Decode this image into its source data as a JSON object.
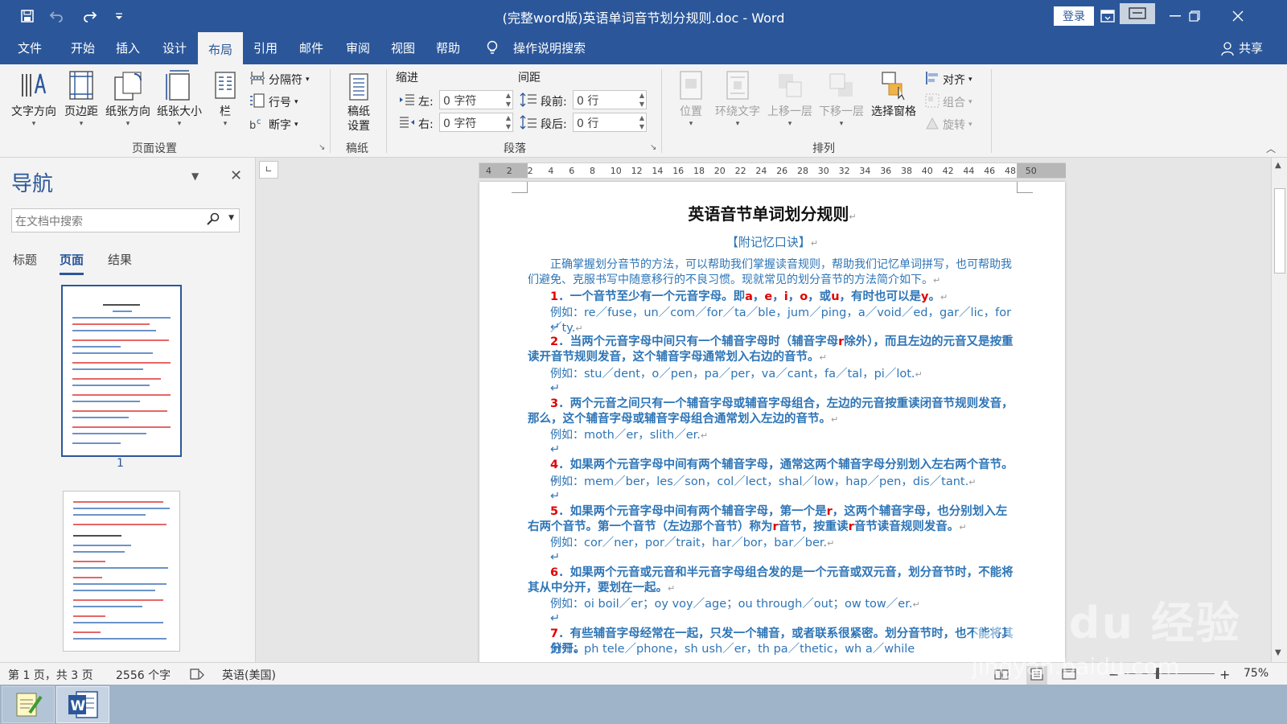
{
  "window": {
    "title": "(完整word版)英语单词音节划分规则.doc  -  Word",
    "login": "登录",
    "qa_icons": [
      "save-icon",
      "undo-icon",
      "redo-icon",
      "customize-icon"
    ]
  },
  "menu": {
    "tabs": [
      {
        "label": "文件"
      },
      {
        "label": "开始"
      },
      {
        "label": "插入"
      },
      {
        "label": "设计"
      },
      {
        "label": "布局",
        "active": true
      },
      {
        "label": "引用"
      },
      {
        "label": "邮件"
      },
      {
        "label": "审阅"
      },
      {
        "label": "视图"
      },
      {
        "label": "帮助"
      }
    ],
    "tell_me": "操作说明搜索",
    "share": "共享"
  },
  "ribbon": {
    "page_setup": {
      "group_label": "页面设置",
      "buttons": [
        "文字方向",
        "页边距",
        "纸张方向",
        "纸张大小",
        "栏"
      ],
      "small": [
        "分隔符",
        "行号",
        "断字"
      ]
    },
    "manuscript": {
      "group_label": "稿纸",
      "button": "稿纸\n设置",
      "button_line1": "稿纸",
      "button_line2": "设置"
    },
    "paragraph": {
      "group_label": "段落",
      "indent_label": "缩进",
      "spacing_label": "间距",
      "left_label": "左:",
      "right_label": "右:",
      "left_value": "0 字符",
      "right_value": "0 字符",
      "before_label": "段前:",
      "after_label": "段后:",
      "before_value": "0 行",
      "after_value": "0 行"
    },
    "arrange": {
      "group_label": "排列",
      "buttons": [
        "位置",
        "环绕文字",
        "上移一层",
        "下移一层",
        "选择窗格"
      ],
      "small": [
        "对齐",
        "组合",
        "旋转"
      ]
    }
  },
  "nav": {
    "title": "导航",
    "search_placeholder": "在文档中搜索",
    "tabs": [
      "标题",
      "页面",
      "结果"
    ],
    "active_tab": "页面",
    "page1_label": "1"
  },
  "ruler": {
    "ticks": [
      "4",
      "2",
      "2",
      "4",
      "6",
      "8",
      "10",
      "12",
      "14",
      "16",
      "18",
      "20",
      "22",
      "24",
      "26",
      "28",
      "30",
      "32",
      "34",
      "36",
      "38",
      "40",
      "42",
      "44",
      "46",
      "48",
      "50"
    ]
  },
  "document": {
    "heading": "英语音节单词划分规则",
    "subheading": "【附记忆口诀】",
    "intro": "正确掌握划分音节的方法，可以帮助我们掌握读音规则，帮助我们记忆单词拼写，也可帮助我们避免、克服书写中随意移行的不良习惯。现就常见的划分音节的方法简介如下。",
    "rules": [
      {
        "num": "1",
        "text_a": "．一个音节至少有一个元音字母。即",
        "letters": [
          "a",
          "e",
          "i",
          "o"
        ],
        "text_b": "，或",
        "letter_u": "u",
        "text_c": "，有时也可以是",
        "letter_y": "y",
        "text_d": "。",
        "example_lead": "例如：",
        "example": "re／fuse，un／com／for／ta／ble，jum／ping，a／void／ed，gar／lic，for／ty."
      },
      {
        "num": "2",
        "text": "．当两个元音字母中间只有一个辅音字母时（辅音字母",
        "r": "r",
        "text2": "除外），而且左边的元音又是按重读开音节规则发音，这个辅音字母通常划入右边的音节。",
        "example_lead": "例如：",
        "example": "stu／dent，o／pen，pa／per，va／cant，fa／tal，pi／lot."
      },
      {
        "num": "3",
        "text": "．两个元音之间只有一个辅音字母或辅音字母组合，左边的元音按重读闭音节规则发音，那么，这个辅音字母或辅音字母组合通常划入左边的音节。",
        "example_lead": "例如：",
        "example": "moth／er，slith／er."
      },
      {
        "num": "4",
        "text": "．如果两个元音字母中间有两个辅音字母，通常这两个辅音字母分别划入左右两个音节。",
        "example_lead": "例如：",
        "example": "mem／ber，les／son，col／lect，shal／low，hap／pen，dis／tant."
      },
      {
        "num": "5",
        "text": "．如果两个元音字母中间有两个辅音字母，第一个是",
        "r": "r",
        "text2": "，这两个辅音字母，也分别划入左右两个音节。第一个音节（左边那个音节）称为",
        "r2": "r",
        "text3": "音节，按重读",
        "r3": "r",
        "text4": "音节读音规则发音。",
        "example_lead": "例如：",
        "example": "cor／ner，por／trait，har／bor，bar／ber."
      },
      {
        "num": "6",
        "text": "．如果两个元音或元音和半元音字母组合发的是一个元音或双元音，划分音节时，不能将其从中分开，要划在一起。",
        "example_lead": "例如：",
        "example": "oi boil／er；oy voy／age；ou through／out；ow tow／er."
      },
      {
        "num": "7",
        "text": "．有些辅音字母经常在一起，只发一个辅音，或者联系很紧密。划分音节时，也不能将其分开。",
        "example_lead": "例如：",
        "example": "ph tele／phone，sh ush／er，th pa／thetic，wh a／while"
      }
    ]
  },
  "status": {
    "page": "第 1 页，共 3 页",
    "words": "2556 个字",
    "language": "英语(美国)",
    "zoom": "75%",
    "zoom_level": 0.75
  },
  "watermark": "Bai du 经验",
  "watermark_url": "jingyan.baidu.com",
  "colors": {
    "accent": "#2b579a",
    "doc_blue": "#2e75b6",
    "rule_red": "#e00000"
  }
}
